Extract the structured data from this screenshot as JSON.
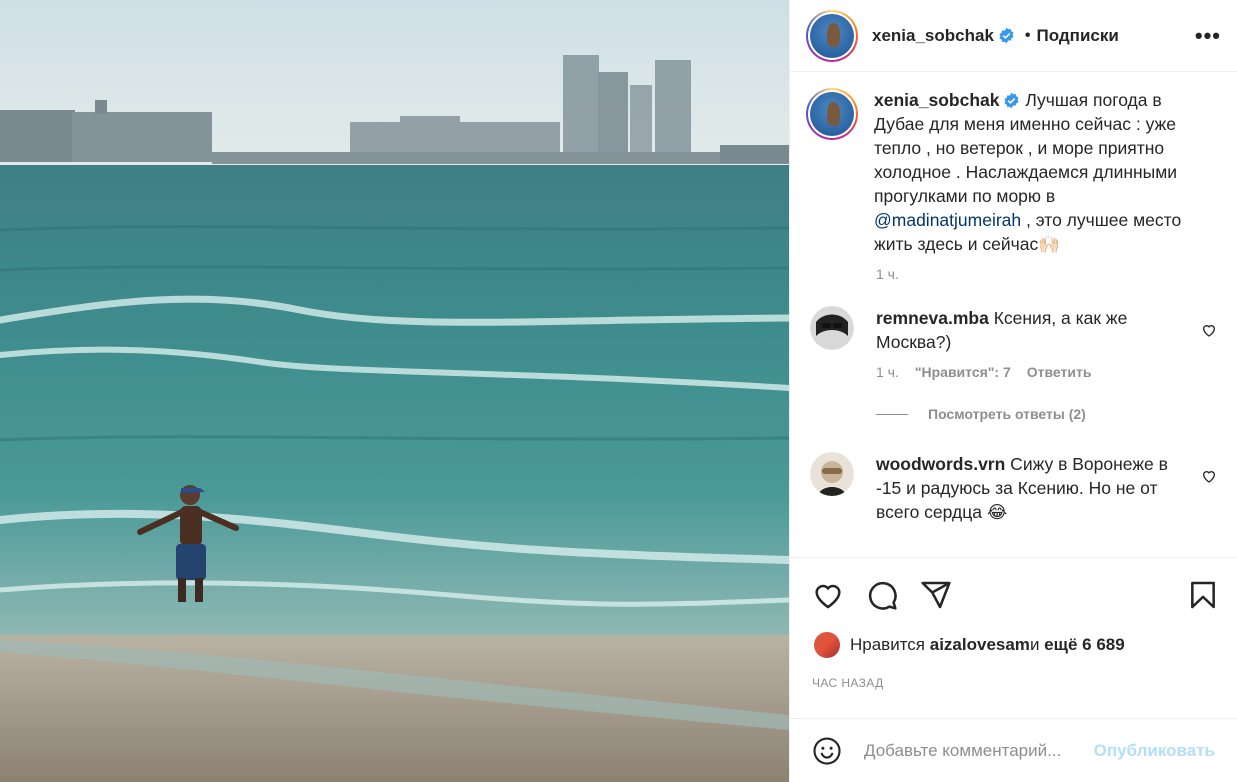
{
  "post": {
    "username": "xenia_sobchak",
    "separator": "•",
    "follow_label": "Подписки",
    "more_label": "•••"
  },
  "caption": {
    "username": "xenia_sobchak",
    "text_before": " Лучшая погода в Дубае для меня именно сейчас : уже тепло , но ветерок , и море приятно холодное . Наслаждаемся длинными прогулками по морю в ",
    "mention": "@madinatjumeirah",
    "text_after": " , это лучшее место жить здесь и сейчас🙌🏻",
    "time": "1 ч."
  },
  "comments": [
    {
      "username": "remneva.mba",
      "text": " Ксения, а как же Москва?)",
      "time": "1 ч.",
      "likes": "\"Нравится\": 7",
      "reply_label": "Ответить",
      "view_replies": "Посмотреть ответы (2)"
    },
    {
      "username": "woodwords.vrn",
      "text": " Сижу в Воронеже в -15 и радуюсь за Ксению. Но не от всего сердца 😂"
    }
  ],
  "likes_line": {
    "prefix": "Нравится ",
    "user": "aizalovesam",
    "middle": " и ",
    "count": "ещё 6 689"
  },
  "timestamp": "час назад",
  "add_comment": {
    "placeholder": "Добавьте комментарий...",
    "publish_label": "Опубликовать"
  },
  "icons": {
    "verified": "verified-badge-icon",
    "like": "heart-icon",
    "comment": "comment-bubble-icon",
    "share": "paper-plane-icon",
    "save": "bookmark-icon",
    "emoji": "smiley-icon",
    "more": "more-horizontal-icon"
  },
  "colors": {
    "verified": "#3897f0",
    "mention": "#00376b",
    "muted": "#8e8e8e",
    "publish": "#b2dffc"
  }
}
